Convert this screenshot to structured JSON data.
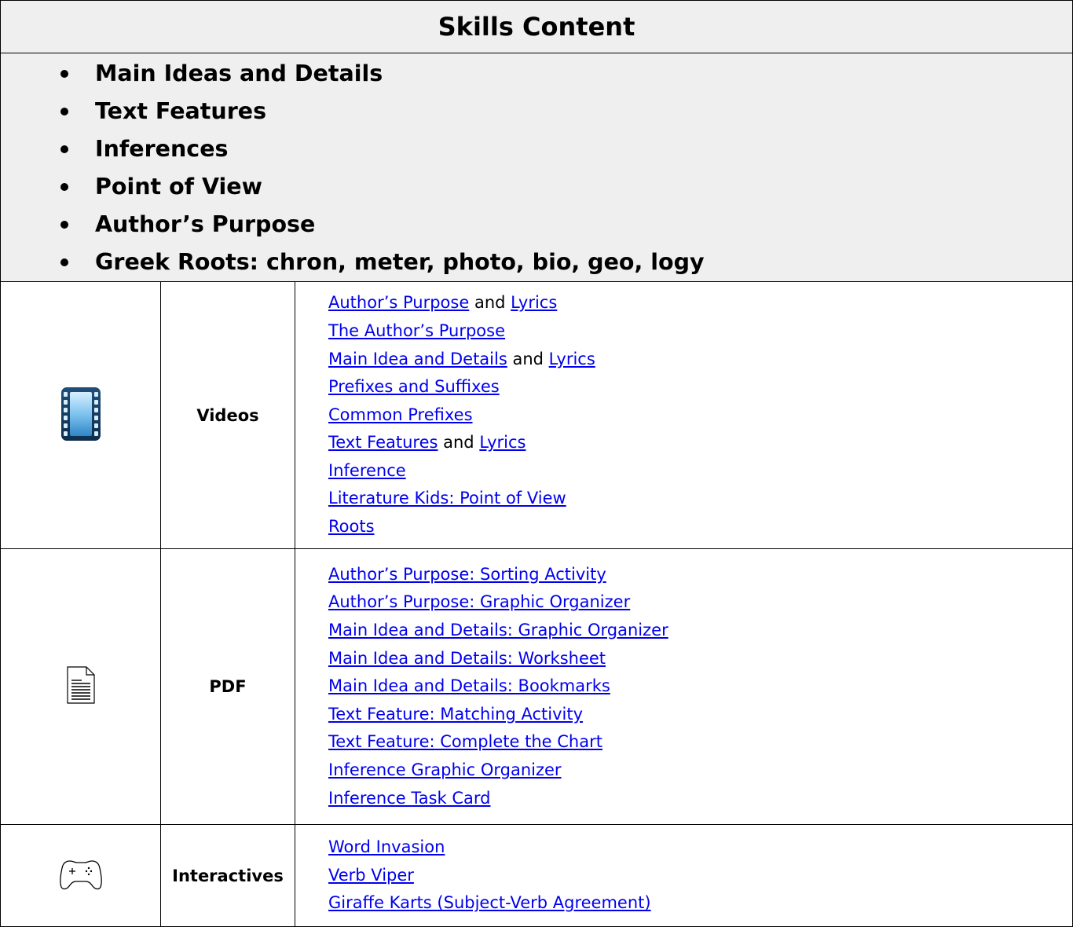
{
  "header": {
    "title": "Skills Content"
  },
  "skills": [
    "Main Ideas and Details",
    "Text Features",
    "Inferences",
    "Point of View",
    "Author’s Purpose",
    "Greek Roots:  chron, meter, photo, bio, geo, logy"
  ],
  "sections": {
    "videos": {
      "icon": "film-strip-icon",
      "label": "Videos",
      "lines": [
        {
          "a": "Author’s Purpose",
          "sep": " and ",
          "b": "Lyrics"
        },
        {
          "a": "The Author’s Purpose"
        },
        {
          "a": "Main Idea and Details",
          "sep": " and ",
          "b": "Lyrics"
        },
        {
          "a": "Prefixes and Suffixes"
        },
        {
          "a": "Common Prefixes"
        },
        {
          "a": "Text Features",
          "sep": " and ",
          "b": "Lyrics"
        },
        {
          "a": "Inference"
        },
        {
          "a": "Literature Kids:  Point of View"
        },
        {
          "a": "Roots"
        }
      ]
    },
    "pdf": {
      "icon": "document-icon",
      "label": "PDF",
      "lines": [
        "Author’s Purpose:  Sorting Activity",
        "Author’s Purpose:  Graphic Organizer",
        "Main Idea and Details:  Graphic Organizer",
        "Main Idea and Details:  Worksheet",
        "Main Idea and Details:  Bookmarks",
        "Text Feature:  Matching Activity",
        "Text Feature:  Complete the Chart",
        "Inference Graphic Organizer",
        "Inference Task Card"
      ]
    },
    "interactives": {
      "icon": "game-controller-icon",
      "label": "Interactives",
      "lines": [
        "Word Invasion",
        "Verb Viper",
        "Giraffe Karts (Subject-Verb Agreement)"
      ]
    }
  },
  "colors": {
    "header_bg": "#efefef",
    "link": "#0000ee",
    "border": "#000000"
  }
}
